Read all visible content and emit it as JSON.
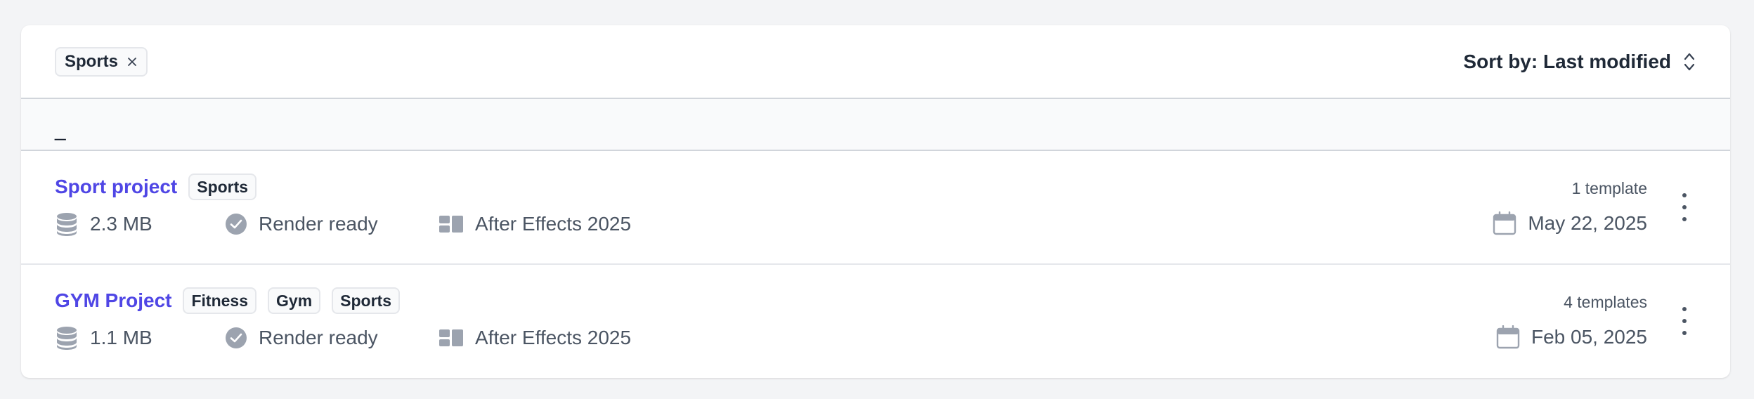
{
  "toolbar": {
    "active_filter": "Sports",
    "sort_label": "Sort by: Last modified"
  },
  "group": {
    "label": "_"
  },
  "projects": [
    {
      "name": "Sport project",
      "tags": [
        "Sports"
      ],
      "size": "2.3 MB",
      "status": "Render ready",
      "software": "After Effects 2025",
      "template_count": "1 template",
      "date": "May 22, 2025"
    },
    {
      "name": "GYM Project",
      "tags": [
        "Fitness",
        "Gym",
        "Sports"
      ],
      "size": "1.1 MB",
      "status": "Render ready",
      "software": "After Effects 2025",
      "template_count": "4 templates",
      "date": "Feb 05, 2025"
    }
  ],
  "icons": {
    "size": "database-icon",
    "status": "check-circle-icon",
    "software": "layout-icon",
    "date": "calendar-icon",
    "menu": "kebab-menu-icon"
  },
  "colors": {
    "accent": "#4f46e5",
    "icon": "#9ca3af"
  }
}
